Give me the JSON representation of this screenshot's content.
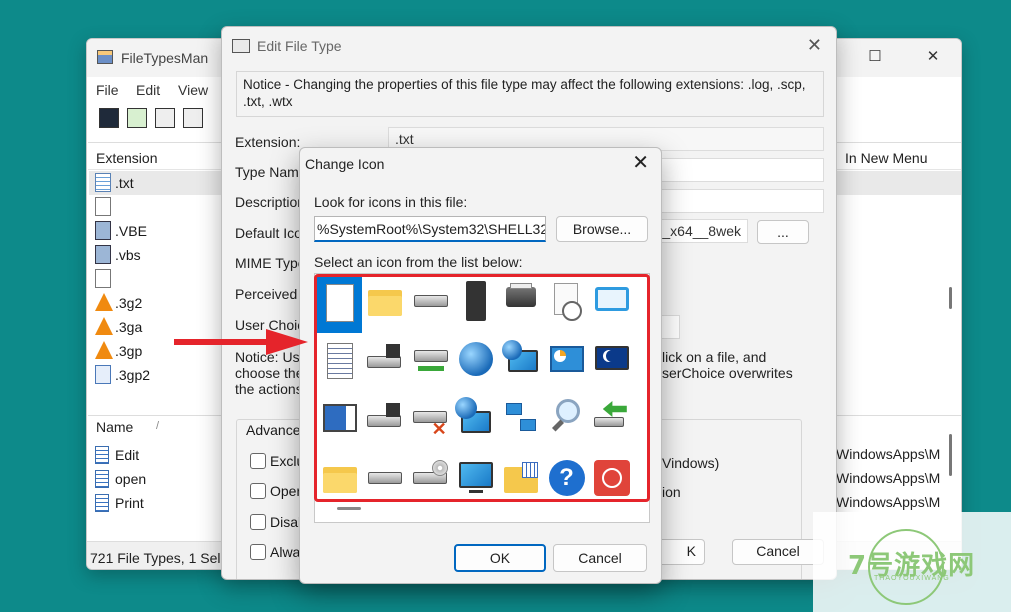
{
  "main_window": {
    "title": "FileTypesMan",
    "menu": [
      "File",
      "Edit",
      "View"
    ],
    "columns": {
      "extension": "Extension",
      "in_new_menu": "In New Menu"
    },
    "files": [
      ".txt",
      "",
      ".VBE",
      ".vbs",
      "",
      ".3g2",
      ".3ga",
      ".3gp",
      ".3gp2"
    ],
    "actions_header": {
      "name": "Name",
      "sort_indicator": "/"
    },
    "actions": [
      "Edit",
      "open",
      "Print"
    ],
    "right_paths": [
      "WindowsApps\\M",
      "WindowsApps\\M",
      "WindowsApps\\M"
    ],
    "status": "721 File Types, 1 Sele"
  },
  "edit_dialog": {
    "title": "Edit File Type",
    "notice": "Notice - Changing the properties of this file type may affect the following extensions: .log, .scp, .txt, .wtx",
    "labels": {
      "extension": "Extension:",
      "type_name": "Type Name",
      "description": "Description",
      "default_icon": "Default Ico",
      "mime_type": "MIME Type",
      "perceived_type": "Perceived T",
      "user_choice": "User Choice"
    },
    "extension_value": ".txt",
    "default_icon_value": "0_x64__8wek",
    "more_button": "...",
    "notice2_left": [
      "Notice: Use",
      "choose the",
      "the actions"
    ],
    "notice2_right": [
      "lick on a file, and",
      "serChoice overwrites"
    ],
    "advanced_legend": "Advanced",
    "checkboxes": [
      "Exclu",
      "Oper",
      "Disab",
      "Alwa"
    ],
    "right_texts": [
      "Vindows)",
      "ion"
    ],
    "ok_fragment": "K",
    "cancel": "Cancel"
  },
  "change_icon": {
    "title": "Change Icon",
    "look_for_label": "Look for icons in this file:",
    "path_value": "%SystemRoot%\\System32\\SHELL32.dll",
    "browse": "Browse...",
    "select_label": "Select an icon from the list below:",
    "ok": "OK",
    "cancel": "Cancel",
    "icon_grid": [
      [
        "blank-document",
        "folder",
        "drive",
        "chip",
        "printer",
        "clock-document",
        "window",
        "shortcut-overlay"
      ],
      [
        "text-document",
        "floppy-drive",
        "network-drive",
        "globe",
        "globe-monitor",
        "control-panel",
        "sleep-monitor",
        "shortcut-arrow"
      ],
      [
        "application-window",
        "floppy-drive",
        "disconnected-drive",
        "network-globe",
        "network",
        "search",
        "recycle-drive",
        "briefcase"
      ],
      [
        "folder",
        "drive",
        "cd-drive",
        "monitor",
        "folder-grid",
        "help",
        "power",
        "partial"
      ]
    ]
  },
  "annotation": {
    "highlight_color": "#e5242b",
    "arrow_color": "#e5242b"
  },
  "watermark": {
    "text": "7号游戏网",
    "sub": "THAOYOUXIWANG"
  }
}
